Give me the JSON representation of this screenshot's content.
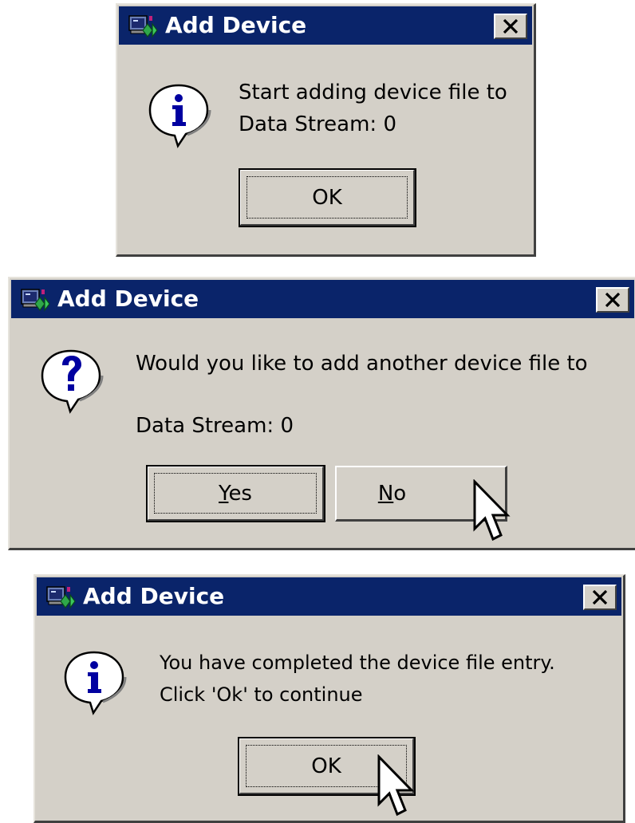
{
  "dialogs": [
    {
      "title": "Add Device",
      "icon": "info-icon",
      "message_line1": "Start adding device file to",
      "message_line2": "Data Stream: 0",
      "buttons": [
        {
          "label": "OK"
        }
      ]
    },
    {
      "title": "Add Device",
      "icon": "question-icon",
      "message_line1": "Would you like to add another device file to",
      "message_line2": "Data Stream: 0",
      "buttons": [
        {
          "label_mnemonic": "Y",
          "label_rest": "es"
        },
        {
          "label_mnemonic": "N",
          "label_rest": "o"
        }
      ]
    },
    {
      "title": "Add Device",
      "icon": "info-icon",
      "message_line1": "You have completed the device file entry.",
      "message_line2": "Click 'Ok' to continue",
      "buttons": [
        {
          "label": "OK"
        }
      ]
    }
  ],
  "icons": {
    "app": "app-device-icon",
    "close": "close-icon",
    "cursor": "mouse-pointer-icon"
  },
  "colors": {
    "titlebar": "#0a246a",
    "dialog_face": "#d4d0c8",
    "title_text": "#ffffff",
    "info_glyph": "#0000a0"
  }
}
